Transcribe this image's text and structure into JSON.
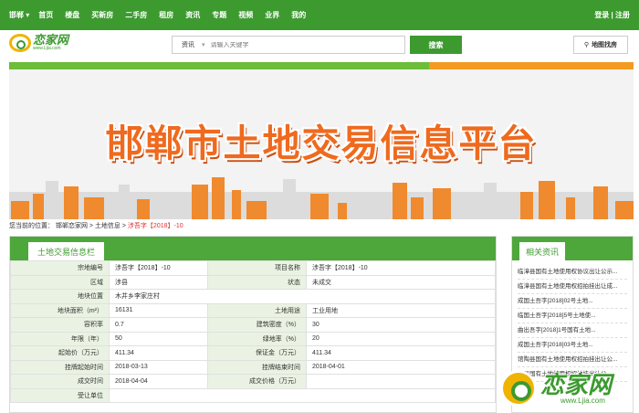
{
  "topnav": {
    "city": "邯郸",
    "items": [
      "首页",
      "楼盘",
      "买新房",
      "二手房",
      "租房",
      "资讯",
      "专题",
      "视频",
      "业界",
      "我的"
    ],
    "right": "登录 | 注册"
  },
  "logo": {
    "name": "恋家网",
    "domain": "www.Ljia.com"
  },
  "search": {
    "type": "资讯",
    "placeholder": "请输入关键字",
    "button": "搜索"
  },
  "map_button": "地图找房",
  "banner": {
    "title": "邯郸市土地交易信息平台"
  },
  "breadcrumb": {
    "prefix": "您当前的位置：",
    "items": [
      "邯郸恋家网",
      "土地信息"
    ],
    "current": "涉吾字【2018】-10"
  },
  "main": {
    "tab": "土地交易信息栏",
    "rows": [
      [
        "宗地编号",
        "涉吾字【2018】-10",
        "项目名称",
        "涉吾字【2018】-10"
      ],
      [
        "区域",
        "涉县",
        "状态",
        "未成交"
      ],
      [
        "地块位置",
        "木井乡李家庄村",
        "",
        ""
      ],
      [
        "地块面积（m²）",
        "16131",
        "土地用途",
        "工业用地"
      ],
      [
        "容积率",
        "0.7",
        "建筑密度（%）",
        "30"
      ],
      [
        "年限（年）",
        "50",
        "绿地率（%）",
        "20"
      ],
      [
        "起始价（万元）",
        "411.34",
        "保证金（万元）",
        "411.34"
      ],
      [
        "挂牌起始时间",
        "2018-03-13",
        "挂牌结束时间",
        "2018-04-01"
      ],
      [
        "成交时间",
        "2018-04-04",
        "成交价格（万元）",
        ""
      ],
      [
        "受让单位",
        "",
        "",
        ""
      ]
    ]
  },
  "side": {
    "tab": "相关资讯",
    "items": [
      "临漳县国有土地使用权协议出让公示...",
      "临漳县国有土地使用权招拍挂出让成...",
      "成国土吾字[2018]02号土地...",
      "临国土吾字[2018]5号土地使...",
      "曲出吾字[2018]1号国有土地...",
      "成国土吾字[2018]03号土地...",
      "馆陶县国有土地使用权招拍挂出让公...",
      "魏县国有土地使用权招拍挂出让公..."
    ]
  },
  "watermark": {
    "name": "恋家网",
    "domain": "www.Ljia.com"
  }
}
